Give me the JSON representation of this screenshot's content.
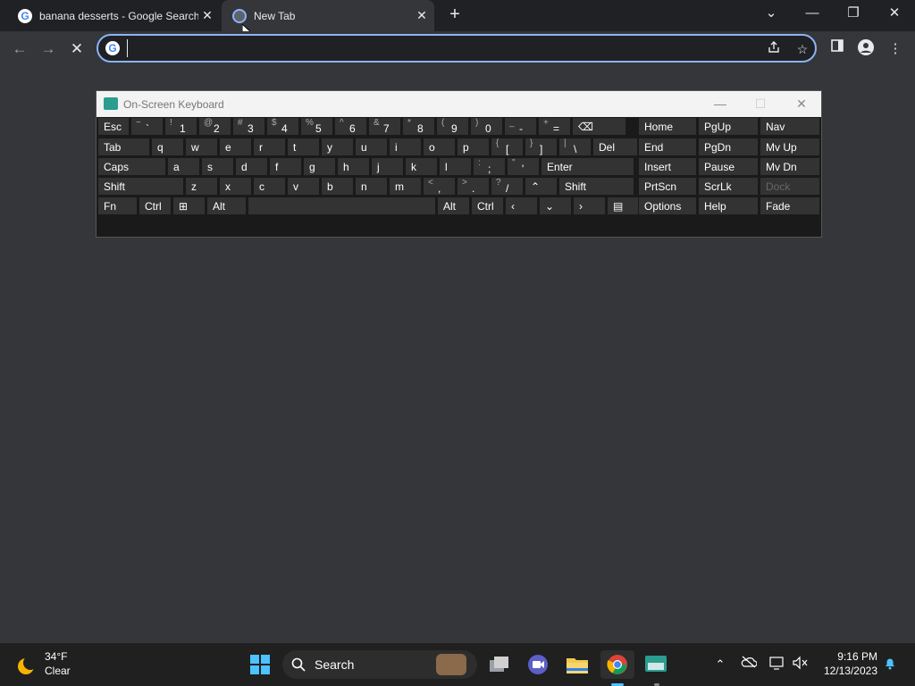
{
  "browser": {
    "tabs": [
      {
        "title": "banana desserts - Google Search",
        "favicon": "google-icon"
      },
      {
        "title": "New Tab",
        "favicon": "chrome-icon"
      }
    ],
    "new_tab_symbol": "+",
    "close_symbol": "✕",
    "window_controls": {
      "dropdown": "⌄",
      "minimize": "—",
      "restore": "❐",
      "close": "✕"
    },
    "nav": {
      "back": "←",
      "forward": "→",
      "stop": "✕"
    },
    "omnibox": {
      "value": "",
      "placeholder": ""
    },
    "toolbar_icons": [
      "share-icon",
      "star-icon",
      "side-panel-icon",
      "profile-icon",
      "menu-icon"
    ]
  },
  "osk": {
    "title": "On-Screen Keyboard",
    "controls": {
      "minimize": "—",
      "maximize": "☐",
      "close": "✕"
    },
    "rows": [
      [
        {
          "label": "Esc"
        },
        {
          "shift": "~",
          "main": "`"
        },
        {
          "shift": "!",
          "main": "1"
        },
        {
          "shift": "@",
          "main": "2"
        },
        {
          "shift": "#",
          "main": "3"
        },
        {
          "shift": "$",
          "main": "4"
        },
        {
          "shift": "%",
          "main": "5"
        },
        {
          "shift": "^",
          "main": "6"
        },
        {
          "shift": "&",
          "main": "7"
        },
        {
          "shift": "*",
          "main": "8"
        },
        {
          "shift": "(",
          "main": "9"
        },
        {
          "shift": ")",
          "main": "0"
        },
        {
          "shift": "_",
          "main": "-"
        },
        {
          "shift": "+",
          "main": "="
        },
        {
          "label": "⌫"
        }
      ],
      [
        {
          "label": "Tab"
        },
        {
          "label": "q"
        },
        {
          "label": "w"
        },
        {
          "label": "e"
        },
        {
          "label": "r"
        },
        {
          "label": "t"
        },
        {
          "label": "y"
        },
        {
          "label": "u"
        },
        {
          "label": "i"
        },
        {
          "label": "o"
        },
        {
          "label": "p"
        },
        {
          "shift": "{",
          "main": "["
        },
        {
          "shift": "}",
          "main": "]"
        },
        {
          "shift": "|",
          "main": "\\"
        },
        {
          "label": "Del"
        }
      ],
      [
        {
          "label": "Caps"
        },
        {
          "label": "a"
        },
        {
          "label": "s"
        },
        {
          "label": "d"
        },
        {
          "label": "f"
        },
        {
          "label": "g"
        },
        {
          "label": "h"
        },
        {
          "label": "j"
        },
        {
          "label": "k"
        },
        {
          "label": "l"
        },
        {
          "shift": ":",
          "main": ";"
        },
        {
          "shift": "\"",
          "main": "'"
        },
        {
          "label": "Enter"
        }
      ],
      [
        {
          "label": "Shift"
        },
        {
          "label": "z"
        },
        {
          "label": "x"
        },
        {
          "label": "c"
        },
        {
          "label": "v"
        },
        {
          "label": "b"
        },
        {
          "label": "n"
        },
        {
          "label": "m"
        },
        {
          "shift": "<",
          "main": ","
        },
        {
          "shift": ">",
          "main": "."
        },
        {
          "shift": "?",
          "main": "/"
        },
        {
          "label": "⌃"
        },
        {
          "label": "Shift"
        }
      ],
      [
        {
          "label": "Fn"
        },
        {
          "label": "Ctrl"
        },
        {
          "label": "⊞"
        },
        {
          "label": "Alt"
        },
        {
          "label": ""
        },
        {
          "label": "Alt"
        },
        {
          "label": "Ctrl"
        },
        {
          "label": "‹"
        },
        {
          "label": "⌄"
        },
        {
          "label": "›"
        },
        {
          "label": "▤"
        }
      ]
    ],
    "nav_keys": [
      [
        "Home",
        "PgUp",
        "Nav"
      ],
      [
        "End",
        "PgDn",
        "Mv Up"
      ],
      [
        "Insert",
        "Pause",
        "Mv Dn"
      ],
      [
        "PrtScn",
        "ScrLk",
        "Dock"
      ],
      [
        "Options",
        "Help",
        "Fade"
      ]
    ]
  },
  "taskbar": {
    "weather": {
      "temp": "34°F",
      "condition": "Clear"
    },
    "search_label": "Search",
    "pinned": [
      "start-icon",
      "task-view-icon",
      "meet-icon",
      "file-explorer-icon",
      "chrome-icon",
      "osk-app-icon"
    ],
    "tray": {
      "chevron": "⌃",
      "time": "9:16 PM",
      "date": "12/13/2023"
    }
  }
}
